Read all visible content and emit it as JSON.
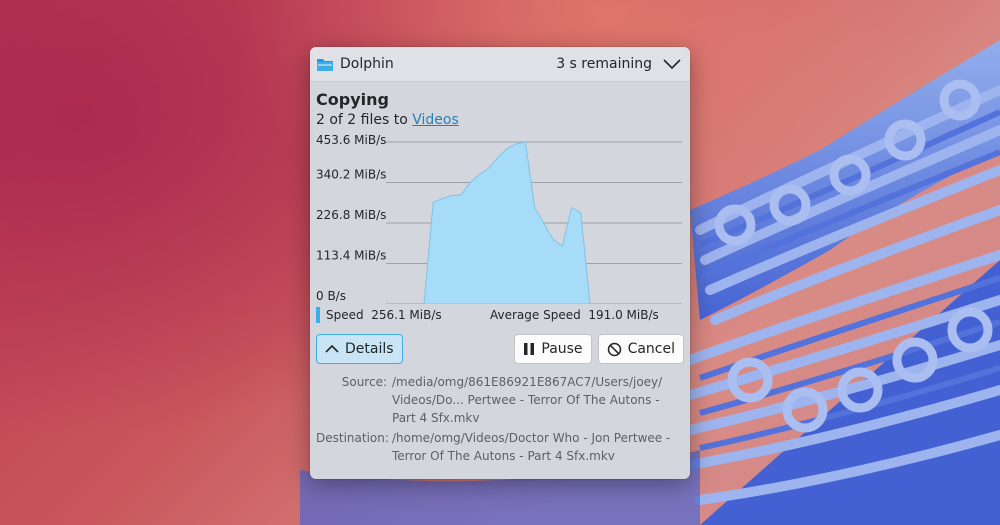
{
  "window": {
    "app_name": "Dolphin",
    "remaining": "3 s remaining"
  },
  "job": {
    "heading": "Copying",
    "files_prefix": "2 of 2 files to ",
    "destination_link": "Videos"
  },
  "chart_data": {
    "type": "area",
    "y_tick_labels": [
      "453.6 MiB/s",
      "340.2 MiB/s",
      "226.8 MiB/s",
      "113.4 MiB/s",
      "0 B/s"
    ],
    "ylim": [
      0,
      453.6
    ],
    "y_unit": "MiB/s",
    "grid": true,
    "series": [
      {
        "color": "#a6dcf7",
        "values": [
          0,
          285,
          295,
          304,
          305,
          340,
          362,
          380,
          410,
          435,
          448,
          453.6,
          270,
          225,
          180,
          162,
          270,
          255,
          0
        ]
      }
    ]
  },
  "stats": {
    "speed_label": "Speed",
    "speed_value": "256.1 MiB/s",
    "avg_label": "Average Speed",
    "avg_value": "191.0 MiB/s",
    "speed_color": "#3daee9"
  },
  "buttons": {
    "details": "Details",
    "pause": "Pause",
    "cancel": "Cancel"
  },
  "details": {
    "source_label": "Source:",
    "source_value": "/media/omg/861E86921E867AC7/Users/joey/ Videos/Do... Pertwee - Terror Of The Autons - Part 4 Sfx.mkv",
    "destination_label": "Destination:",
    "destination_value": "/home/omg/Videos/Doctor Who - Jon Pertwee - Terror Of The Autons - Part 4 Sfx.mkv"
  },
  "icons": {
    "app": "dolphin-folder-icon",
    "collapse": "chevron-down-icon",
    "details": "chevron-up-icon",
    "pause": "pause-icon",
    "cancel": "cancel-icon"
  },
  "colors": {
    "accent": "#3daee9",
    "link": "#2980b9",
    "chart_fill": "#a6dcf7"
  }
}
